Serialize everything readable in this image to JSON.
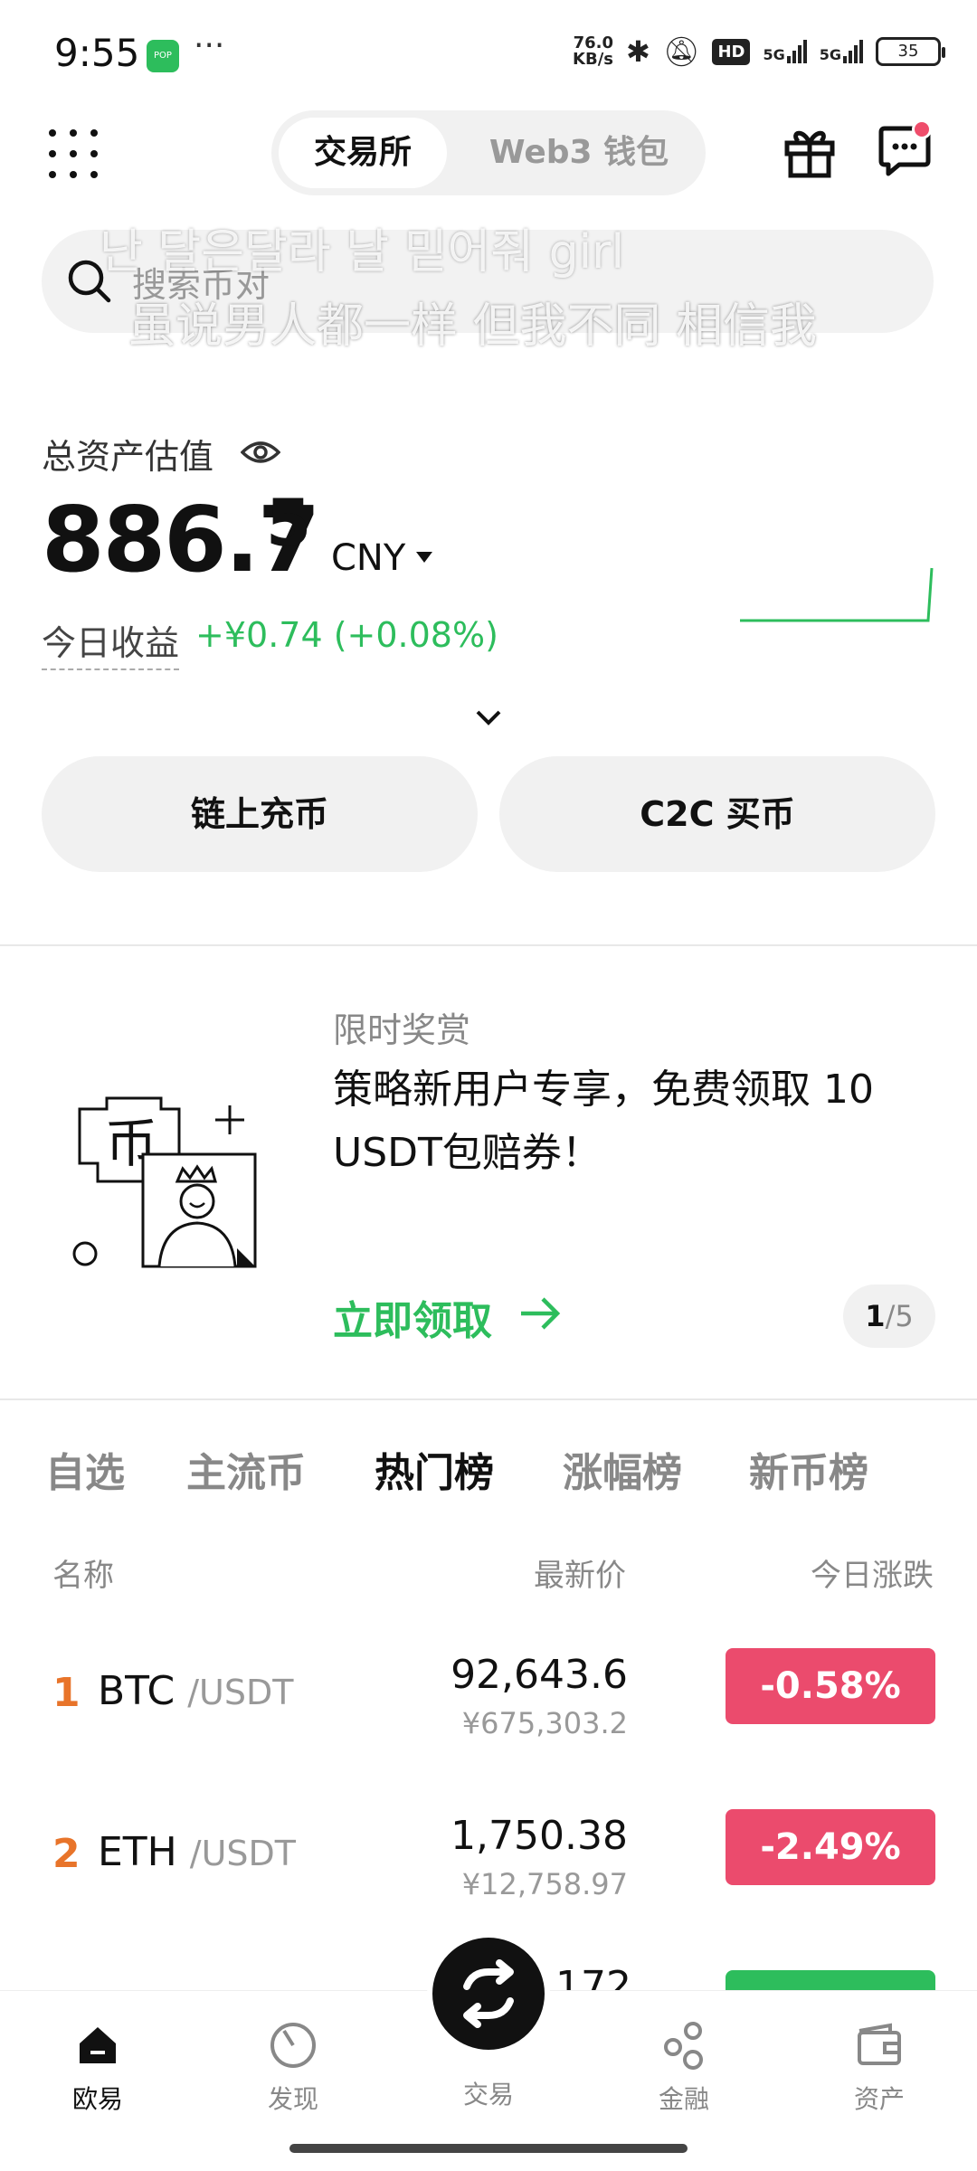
{
  "status_bar": {
    "time": "9:55",
    "app_badge": "POP",
    "dots": "···",
    "net_speed_value": "76.0",
    "net_speed_unit": "KB/s",
    "hd": "HD",
    "sig1": "5G",
    "sig2": "5G",
    "battery": "35"
  },
  "header": {
    "tab_exchange": "交易所",
    "tab_web3": "Web3 钱包"
  },
  "search": {
    "placeholder": "搜索币对"
  },
  "overlay": {
    "line1": "난 달은달라 날 믿어줘 girl",
    "line2": "虽说男人都一样 但我不同 相信我"
  },
  "assets": {
    "label": "总资产估值",
    "value_main": "886.7",
    "value_sup": "5",
    "currency": "CNY",
    "pnl_label": "今日收益",
    "pnl_value": "+¥0.74 (+0.08%)"
  },
  "actions": {
    "deposit": "链上充币",
    "c2c": "C2C 买币"
  },
  "promo": {
    "tag": "限时奖赏",
    "title": "策略新用户专享，免费领取 10 USDT包赔券！",
    "cta": "立即领取",
    "page_current": "1",
    "page_total": "/5"
  },
  "market": {
    "tabs": [
      "自选",
      "主流币",
      "热门榜",
      "涨幅榜",
      "新币榜"
    ],
    "active_tab": "热门榜",
    "headers": {
      "name": "名称",
      "price": "最新价",
      "change": "今日涨跌"
    },
    "rows": [
      {
        "rank": "1",
        "base": "BTC",
        "quote": "/USDT",
        "price": "92,643.6",
        "price_cny": "¥675,303.2",
        "change": "-0.58%"
      },
      {
        "rank": "2",
        "base": "ETH",
        "quote": "/USDT",
        "price": "1,750.38",
        "price_cny": "¥12,758.97",
        "change": "-2.49%"
      }
    ],
    "partial_price": "172"
  },
  "bottom_nav": {
    "home": "欧易",
    "discover": "发现",
    "trade": "交易",
    "finance": "金融",
    "assets": "资产"
  },
  "colors": {
    "green": "#2dbd5c",
    "red": "#eb4b6d",
    "rank_orange": "#e8742a"
  }
}
